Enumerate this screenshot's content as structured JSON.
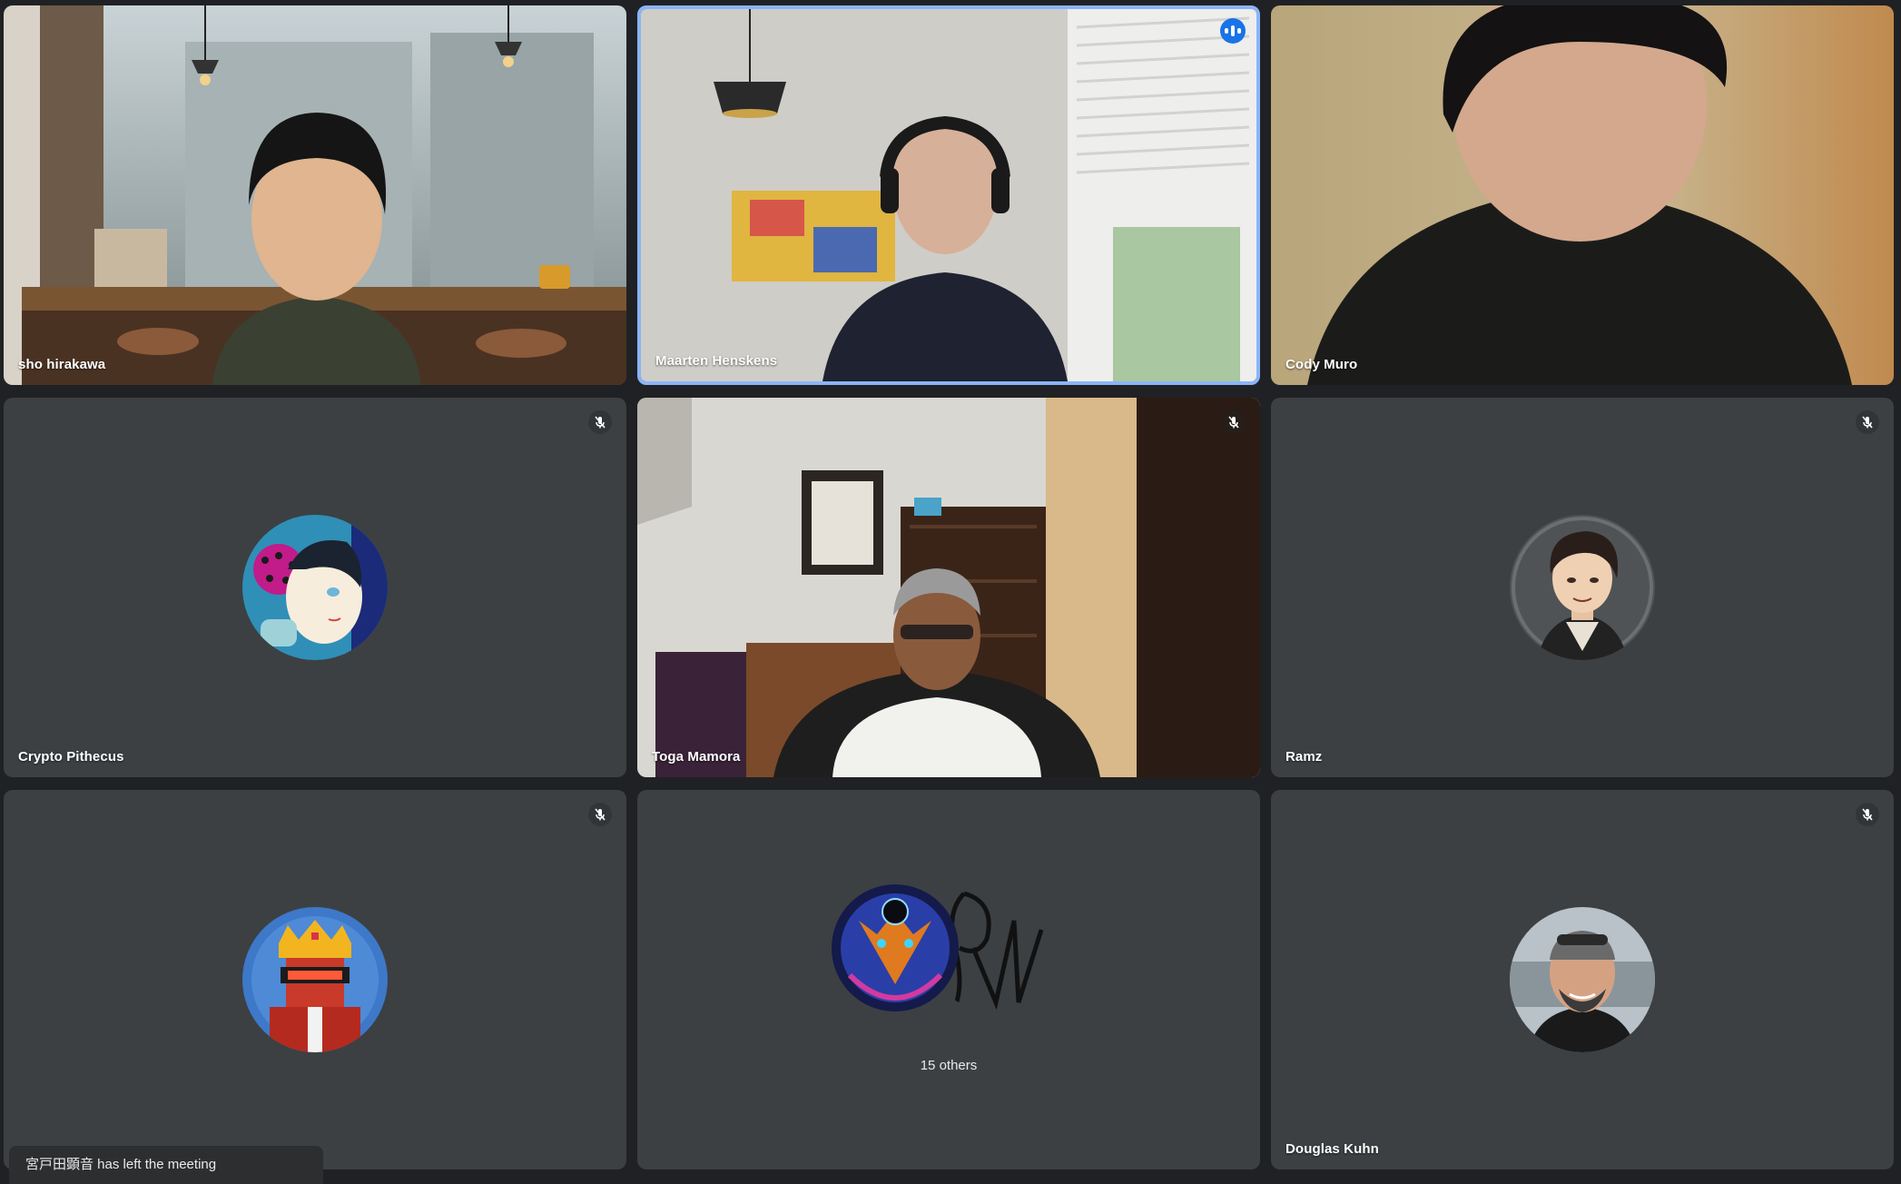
{
  "participants": [
    {
      "name": "sho hirakawa",
      "muted": false,
      "video": true
    },
    {
      "name": "Maarten Henskens",
      "muted": false,
      "video": true,
      "speaking": true
    },
    {
      "name": "Cody Muro",
      "muted": false,
      "video": true
    },
    {
      "name": "Crypto Pithecus",
      "muted": true,
      "video": false,
      "avatar": "anime-portrait"
    },
    {
      "name": "Toga Mamora",
      "muted": true,
      "video": true
    },
    {
      "name": "Ramz",
      "muted": true,
      "video": false,
      "avatar": "cartoon-portrait"
    },
    {
      "name": "",
      "muted": true,
      "video": false,
      "avatar": "pixel-king"
    },
    {
      "name": "Douglas Kuhn",
      "muted": true,
      "video": false,
      "avatar": "photo-portrait"
    }
  ],
  "others": {
    "label": "15 others"
  },
  "notification": {
    "text": "宮戸田顕音 has left the meeting"
  },
  "colors": {
    "background": "#202124",
    "tile": "#3c4043",
    "speaking_border": "#8ab4f8",
    "speaking_badge": "#1a73e8"
  },
  "icons": {
    "mute": "mic-off-icon",
    "speaking": "audio-level-icon"
  }
}
